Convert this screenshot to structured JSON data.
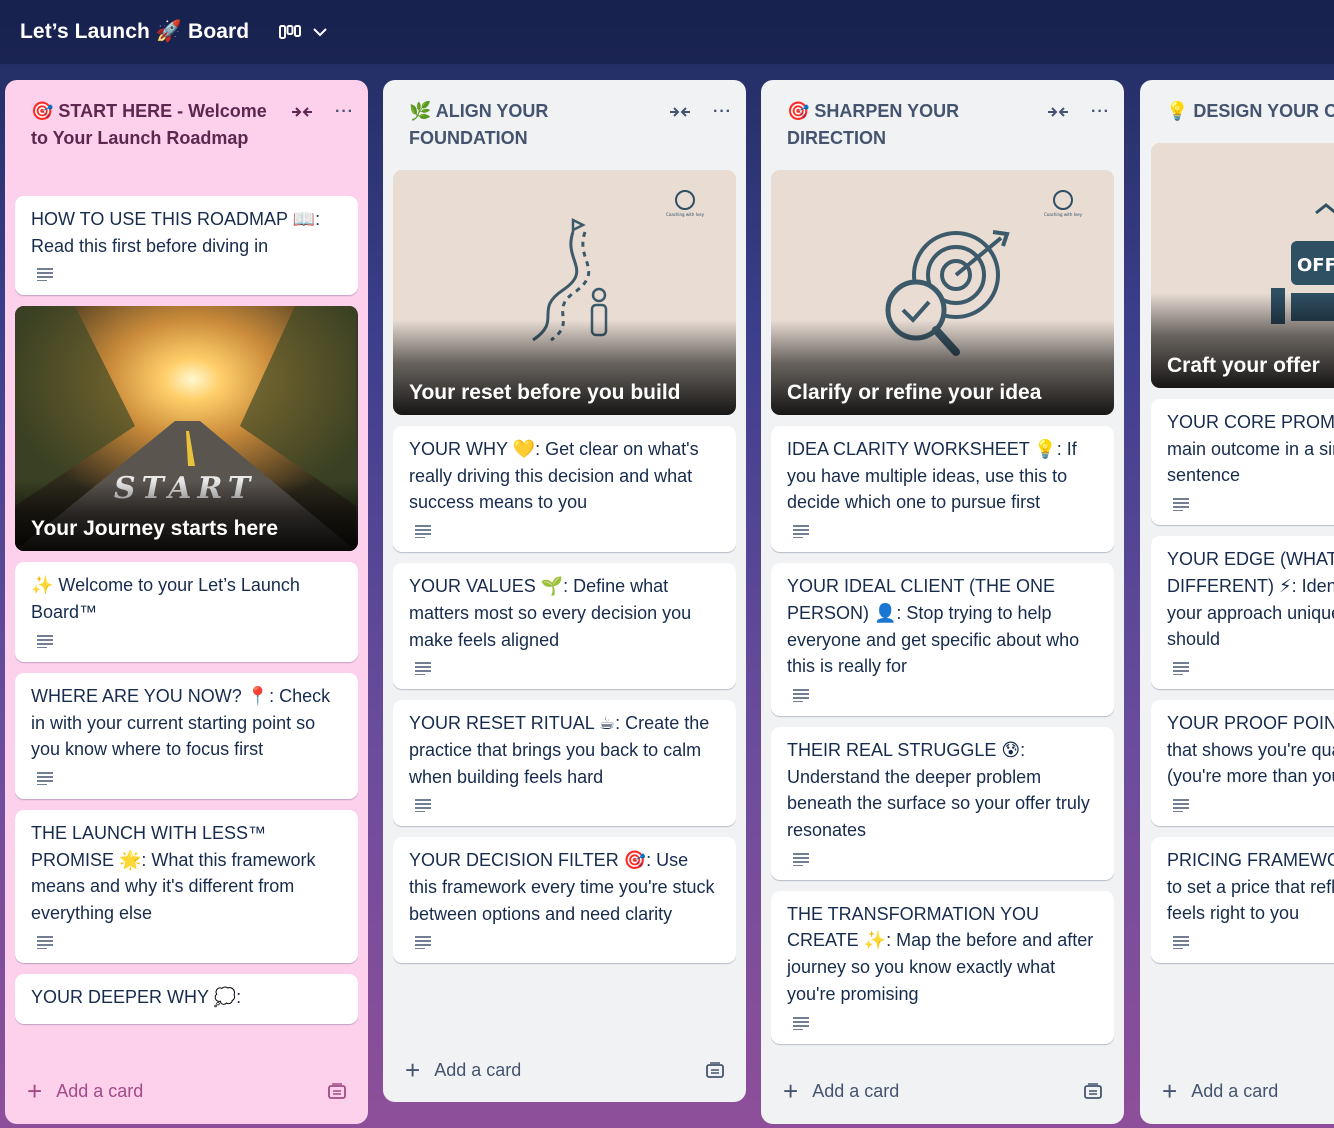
{
  "board": {
    "title": "Let’s Launch 🚀 Board"
  },
  "lists": [
    {
      "title": "🎯 START HERE - Welcome to Your Launch Roadmap",
      "cards": [
        "HOW TO USE THIS ROADMAP 📖: Read this first before diving in",
        "✨ Welcome to your Let’s Launch Board™",
        "WHERE ARE YOU NOW? 📍: Check in with your current starting point so you know where to focus first",
        "THE LAUNCH WITH LESS™ PROMISE 🌟: What this framework means and why it's different from everything else",
        "YOUR DEEPER WHY 💭:"
      ],
      "cover": {
        "caption": "Your Journey starts here",
        "image_text": "START"
      },
      "add_card": "Add a card"
    },
    {
      "title": "🌿 ALIGN YOUR FOUNDATION",
      "cover": {
        "caption": "Your reset before you build",
        "logo_text": "Coaching with Ivey"
      },
      "cards": [
        "YOUR WHY 💛: Get clear on what's really driving this decision and what success means to you",
        "YOUR VALUES 🌱: Define what matters most so every decision you make feels aligned",
        "YOUR RESET RITUAL ☕: Create the practice that brings you back to calm when building feels hard",
        "YOUR DECISION FILTER 🎯: Use this framework every time you're stuck between options and need clarity"
      ],
      "add_card": "Add a card"
    },
    {
      "title": "🎯 SHARPEN YOUR DIRECTION",
      "cover": {
        "caption": "Clarify or refine your idea",
        "logo_text": "Coaching with Ivey"
      },
      "cards": [
        "IDEA CLARITY WORKSHEET 💡: If you have multiple ideas, use this to decide which one to pursue first",
        "YOUR IDEAL CLIENT (THE ONE PERSON) 👤: Stop trying to help everyone and get specific about who this is really for",
        "THEIR REAL STRUGGLE 😰: Understand the deeper problem beneath the surface so your offer truly resonates",
        "THE TRANSFORMATION YOU CREATE ✨: Map the before and after journey so you know exactly what you're promising"
      ],
      "add_card": "Add a card"
    },
    {
      "title": "💡 DESIGN YOUR OFFER",
      "cover": {
        "caption": "Craft your offer",
        "image_text": "OFF"
      },
      "cards": [
        "YOUR CORE PROMISE: the ONE main outcome in a single clear sentence",
        "YOUR EDGE (WHAT MAKES YOU DIFFERENT) ⚡: Identify what makes your approach unique and why people should",
        "YOUR PROOF POINTS: the evidence that shows you're qualified to help (you're more than you think)",
        "PRICING FRAMEWORK: these factors to set a price that reflects value and feels right to you"
      ],
      "add_card": "Add a card"
    }
  ]
}
